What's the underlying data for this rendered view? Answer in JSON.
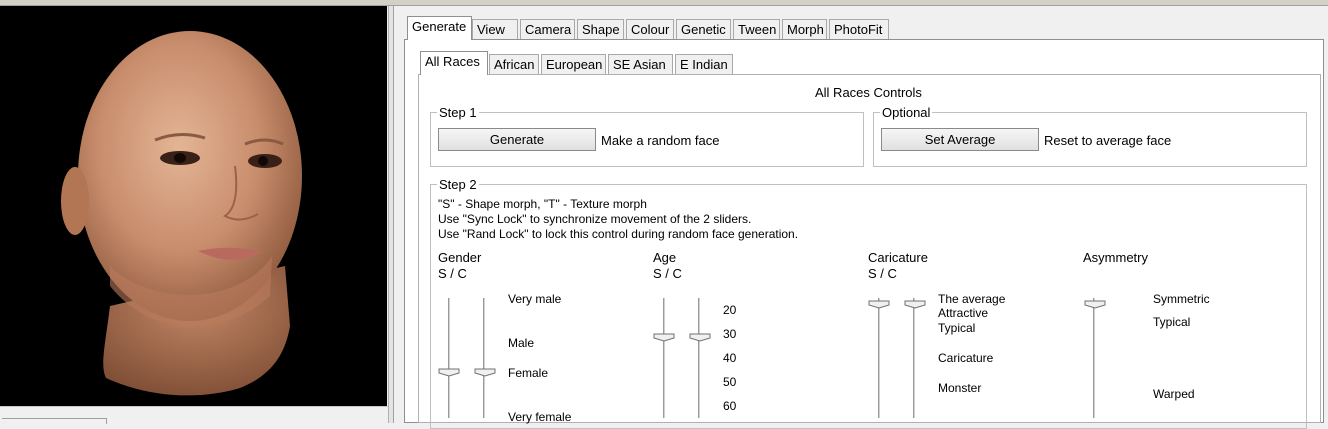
{
  "main_tabs": [
    "Generate",
    "View",
    "Camera",
    "Shape",
    "Colour",
    "Genetic",
    "Tween",
    "Morph",
    "PhotoFit"
  ],
  "sub_tabs": [
    "All Races",
    "African",
    "European",
    "SE Asian",
    "E Indian"
  ],
  "panel_title": "All Races Controls",
  "step1": {
    "title": "Step 1",
    "button": "Generate",
    "description": "Make a random face"
  },
  "optional": {
    "title": "Optional",
    "button": "Set Average",
    "description": "Reset to average face"
  },
  "step2": {
    "title": "Step 2",
    "help": [
      "\"S\" - Shape morph, \"T\" - Texture morph",
      "Use \"Sync Lock\" to synchronize movement of the 2 sliders.",
      "Use \"Rand Lock\" to lock this control during random face generation."
    ],
    "controls": [
      {
        "name": "Gender",
        "sub": "S / C",
        "labels": [
          "Very male",
          "Male",
          "Female",
          "Very female"
        ],
        "s_level": 0.64,
        "t_level": 0.64
      },
      {
        "name": "Age",
        "sub": "S / C",
        "labels": [
          "20",
          "30",
          "40",
          "50",
          "60"
        ],
        "s_level": 0.36,
        "t_level": 0.36
      },
      {
        "name": "Caricature",
        "sub": "S / C",
        "labels": [
          "The average",
          "Attractive",
          "Typical",
          "Caricature",
          "Monster"
        ],
        "s_level": 0.06,
        "t_level": 0.06
      },
      {
        "name": "Asymmetry",
        "sub": "",
        "labels": [
          "Symmetric",
          "Typical",
          "Warped"
        ],
        "level": 0.06
      }
    ]
  },
  "colors": {
    "viewport_bg": "#000000",
    "panel_bg": "#ffffff",
    "chrome": "#f0f0f0"
  }
}
